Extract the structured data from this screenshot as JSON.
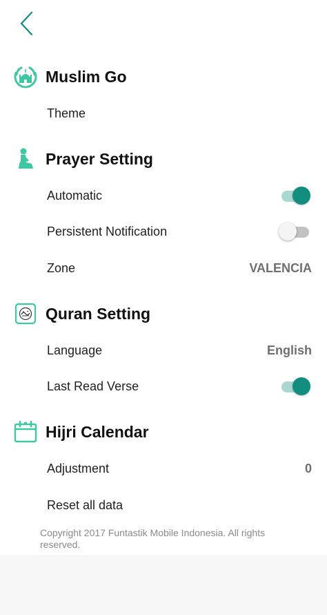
{
  "colors": {
    "accent": "#138d7d",
    "icon": "#3fc7a4",
    "value_text": "#6f6f6f"
  },
  "icons": {
    "back": "chevron-left-icon",
    "muslim_go": "mosque-icon",
    "prayer": "praying-person-icon",
    "quran": "quran-book-icon",
    "hijri": "calendar-icon"
  },
  "sections": {
    "muslim_go": {
      "title": "Muslim Go",
      "theme_label": "Theme"
    },
    "prayer": {
      "title": "Prayer Setting",
      "automatic_label": "Automatic",
      "automatic_on": true,
      "persistent_label": "Persistent Notification",
      "persistent_on": false,
      "zone_label": "Zone",
      "zone_value": "VALENCIA"
    },
    "quran": {
      "title": "Quran Setting",
      "language_label": "Language",
      "language_value": "English",
      "last_read_label": "Last Read Verse",
      "last_read_on": true
    },
    "hijri": {
      "title": "Hijri Calendar",
      "adjustment_label": "Adjustment",
      "adjustment_value": "0",
      "reset_label": "Reset all data"
    }
  },
  "footer": {
    "copyright": "Copyright 2017 Funtastik Mobile Indonesia. All rights reserved."
  }
}
